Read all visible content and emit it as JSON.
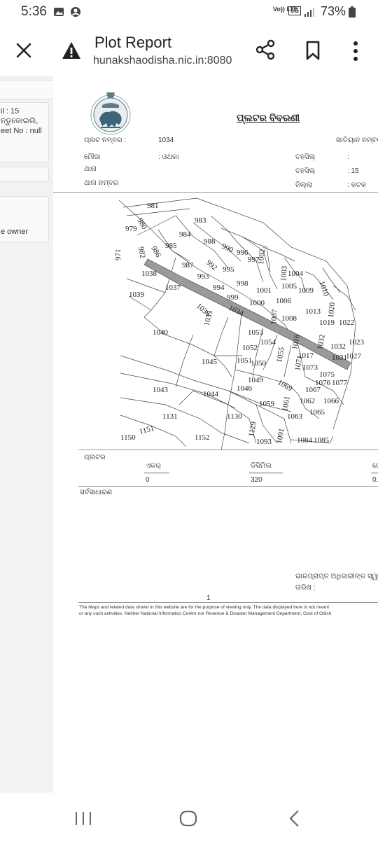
{
  "status_bar": {
    "time": "5:36",
    "volte": "Vo)) LTE",
    "net": "5G",
    "battery": "73%"
  },
  "toolbar": {
    "title": "Plot Report",
    "url": "hunakshaodisha.nic.in:8080"
  },
  "left_panel": {
    "line1": "il : 15",
    "line2": "ନ୍ତୁକୋଇଲି,",
    "line3": "eet No : null",
    "line4": "e owner"
  },
  "report": {
    "title": "ପ୍ଲଟର ବିବରଣୀ",
    "plot_no_label": "ପ୍ଲଟ ନମ୍ବର :",
    "plot_no_value": "1034",
    "khatiyan_label": "ଖାତିୟାନ ନମ୍ବର:",
    "mouza_label": "ମୌଜା",
    "mouza_value": ": ଓଥକା",
    "tahasil_label": "ତହସିଲ୍",
    "tahasil_value": ":",
    "thana_label": "ଥାନା",
    "tahasil2_label": "ତହସିଲ୍",
    "tahasil2_value": ": 15",
    "thana_no_label": "ଥାନା ନମ୍ବର",
    "district_label": "ଜିଲ୍ଲା",
    "district_value": ": କଟକ",
    "plot_section_label": "ପ୍ଲଟର",
    "acre_label": "ଏକର୍",
    "acre_value": "0",
    "decimal_label": "ଡିସିମିଲ",
    "decimal_value": "320",
    "hectare_label_partial": "ଗେ",
    "hectare_value_partial": "0.",
    "public_label": "ସର୍ବସାଧାରଣ",
    "signature_label": "ଭାରପ୍ରାପ୍ତ ଅଧିକାରୀଙ୍କ ସ୍ୱାକ୍ଷର",
    "date_label": "ତାରିଖ :",
    "page_number": "1",
    "disclaimer_1": "The Maps and related data shown in this website are for the purpose of viewing only. The data displayed here is not meant",
    "disclaimer_2": "or any such activities. Neither National Informatics Centre nor Revenue & Disaster Management Department, Govt of Odish"
  },
  "map": {
    "highlight_color": "#9a9a9a",
    "parcels": [
      "981",
      "979",
      "980",
      "983",
      "984",
      "985",
      "986",
      "982",
      "971",
      "988",
      "990",
      "996",
      "997",
      "1002",
      "987",
      "992",
      "995",
      "993",
      "1038",
      "1037",
      "994",
      "998",
      "1001",
      "1003",
      "1004",
      "1005",
      "1009",
      "1010",
      "1039",
      "999",
      "1000",
      "1006",
      "1036",
      "1035",
      "1034",
      "1007",
      "1008",
      "1013",
      "1020",
      "1019",
      "1022",
      "1040",
      "1053",
      "1054",
      "1016",
      "1017",
      "1032",
      "1023",
      "1052",
      "1055",
      "1071",
      "1031",
      "1027",
      "1045",
      "1051",
      "1050",
      "1073",
      "1075",
      "1049",
      "1069",
      "1076",
      "1077",
      "1043",
      "1046",
      "1067",
      "1044",
      "1059",
      "1061",
      "1062",
      "1066",
      "1131",
      "1130",
      "1065",
      "1063",
      "1151",
      "1129",
      "1150",
      "1152",
      "1093",
      "1091",
      "1084",
      "1085"
    ]
  }
}
